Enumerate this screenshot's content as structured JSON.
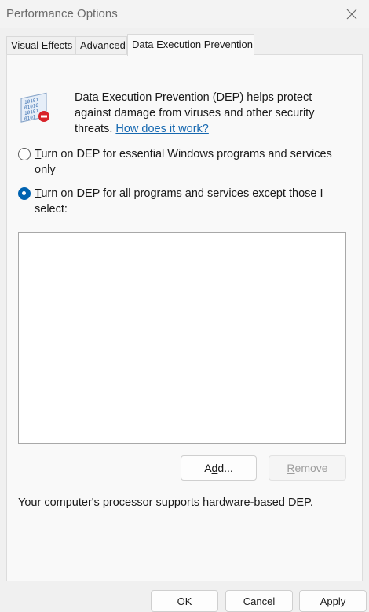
{
  "window": {
    "title": "Performance Options"
  },
  "tabs": [
    {
      "label": "Visual Effects"
    },
    {
      "label": "Advanced"
    },
    {
      "label": "Data Execution Prevention",
      "active": true
    }
  ],
  "dep": {
    "description": "Data Execution Prevention (DEP) helps protect against damage from viruses and other security threats.",
    "link": "How does it work?",
    "options": [
      {
        "accel": "T",
        "rest": "urn on DEP for essential Windows programs and services only",
        "checked": false
      },
      {
        "accel": "T",
        "rest": "urn on DEP for all programs and services except those I select:",
        "checked": true
      }
    ],
    "add_button": {
      "pre": "A",
      "accel": "d",
      "post": "d..."
    },
    "remove_button": {
      "accel": "R",
      "post": "emove",
      "disabled": true
    },
    "support_text": "Your computer's processor supports hardware-based DEP."
  },
  "footer": {
    "ok": "OK",
    "cancel": "Cancel",
    "apply": "Apply",
    "apply_accel": "A",
    "apply_rest": "pply"
  },
  "icons": {
    "close": "close-icon",
    "dep": "dep-shield-icon"
  }
}
